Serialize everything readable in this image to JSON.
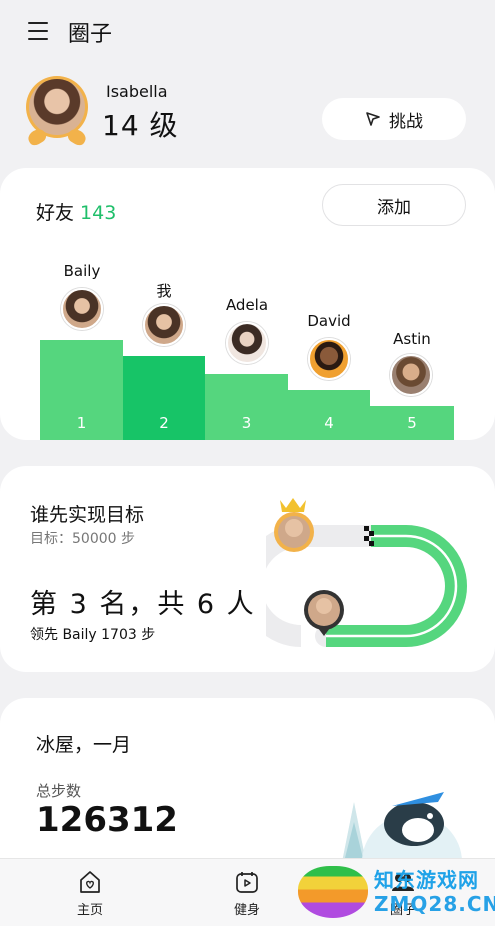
{
  "header": {
    "title": "圈子"
  },
  "profile": {
    "name": "Isabella",
    "level": "14 级",
    "challenge_label": "挑战"
  },
  "friends": {
    "title": "好友",
    "count": "143",
    "add_label": "添加",
    "ranking": [
      {
        "name": "Baily",
        "rank": "1"
      },
      {
        "name": "我",
        "rank": "2"
      },
      {
        "name": "Adela",
        "rank": "3"
      },
      {
        "name": "David",
        "rank": "4"
      },
      {
        "name": "Astin",
        "rank": "5"
      }
    ]
  },
  "race": {
    "title": "谁先实现目标",
    "goal": "目标：50000 步",
    "rank_text": "第 3 名，共 6 人",
    "lead_text": "领先 Baily 1703 步"
  },
  "igloo": {
    "title": "冰屋，一月",
    "steps_label": "总步数",
    "steps_value": "126312"
  },
  "nav": {
    "home": "主页",
    "fitness": "健身",
    "circle": "圈子"
  },
  "watermark": {
    "line1": "知东游戏网",
    "line2": "ZMQ28.CN"
  },
  "colors": {
    "accent": "#17c467",
    "bar": "#55d67e",
    "gold": "#f2b24a"
  }
}
